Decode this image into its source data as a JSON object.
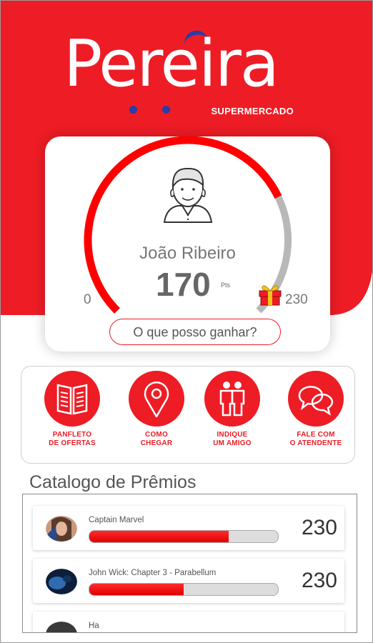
{
  "brand": {
    "name": "Pereira",
    "subtitle": "SUPERMERCADO",
    "colors": {
      "primary": "#ee1c25",
      "accent": "#2a3da8"
    }
  },
  "profile": {
    "name": "João Ribeiro",
    "points": "170",
    "points_unit": "Pts",
    "gauge_min": "0",
    "gauge_max": "230",
    "gauge_progress": 0.739,
    "avatar_icon": "user-avatar-icon",
    "gift_icon": "gift-icon",
    "earn_button": "O que posso ganhar?"
  },
  "actions": [
    {
      "label_line1": "PANFLETO",
      "label_line2": "DE OFERTAS",
      "icon": "newspaper-icon"
    },
    {
      "label_line1": "COMO",
      "label_line2": "CHEGAR",
      "icon": "map-pin-icon"
    },
    {
      "label_line1": "INDIQUE",
      "label_line2": "UM AMIGO",
      "icon": "people-icon"
    },
    {
      "label_line1": "FALE COM",
      "label_line2": "O ATENDENTE",
      "icon": "chat-bubbles-icon"
    }
  ],
  "catalog": {
    "title": "Catalogo de Prêmios",
    "items": [
      {
        "name": "Captain Marvel",
        "points": "230",
        "progress": 0.739
      },
      {
        "name": "John Wick: Chapter 3 - Parabellum",
        "points": "230",
        "progress": 0.5
      },
      {
        "name": "Ha",
        "points": "",
        "progress": 0
      }
    ]
  }
}
